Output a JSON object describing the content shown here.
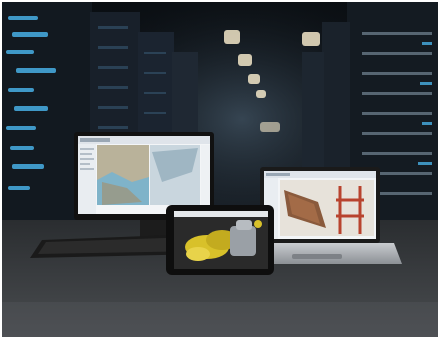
{
  "scene": {
    "description_free": true,
    "devices": [
      "desktop-monitor",
      "keyboard",
      "tablet",
      "laptop"
    ]
  },
  "colors": {
    "background_dark": "#0d1116",
    "server_rack": "#1b2430",
    "server_light_blue": "#4fc3ff",
    "ceiling_light": "#f2e6c8",
    "floor": "#3a3d40",
    "device_bezel": "#111111",
    "screen_ui_white": "#f3f5f7",
    "map_water": "#7fb3c9",
    "map_land": "#b9b29a",
    "bridge_red": "#b8432e",
    "bridge_brown": "#8a5a3c",
    "tablet_yellow": "#d8c12a"
  }
}
